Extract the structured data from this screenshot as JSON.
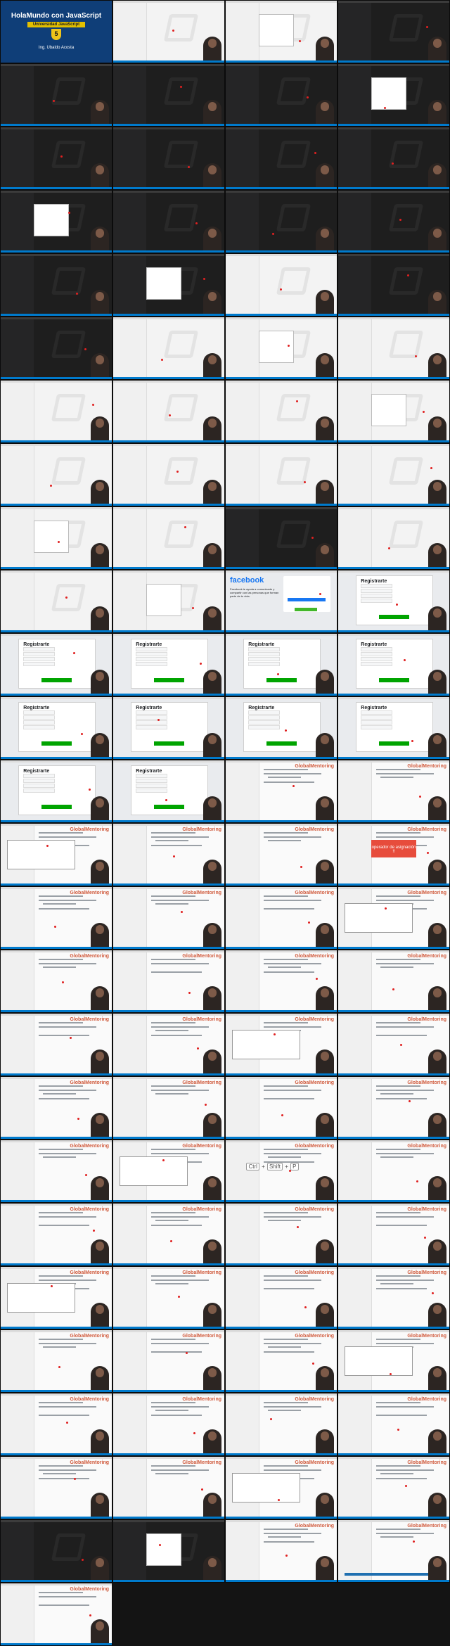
{
  "hero": {
    "title": "HolaMundo con JavaScript",
    "subtitle": "Universidad JavaScript",
    "author": "Ing. Ubaldo Acosta",
    "badge": "5"
  },
  "facebook": {
    "logo": "facebook",
    "tagline": "Facebook te ayuda a comunicarte y compartir con las personas que forman parte de tu vida."
  },
  "register": {
    "title": "Registrarte"
  },
  "callout": {
    "text": "operador de asignación !!"
  },
  "shortcut": {
    "keys": [
      "Ctrl",
      "Shift",
      "P"
    ]
  },
  "brand": {
    "logo_text": "GlobalMentoring"
  },
  "colors": {
    "vscode_blue": "#007acc",
    "facebook_blue": "#1877f2",
    "accent_red": "#e74c3c",
    "hero_bg": "#0f3e78"
  },
  "thumbnails": [
    "hero",
    "light",
    "light",
    "dark",
    "dark",
    "dark",
    "dark",
    "dark",
    "dark",
    "dark",
    "dark",
    "dark",
    "dark",
    "dark",
    "dark",
    "dark",
    "dark",
    "dark",
    "light",
    "dark",
    "dark",
    "light",
    "light",
    "light",
    "light",
    "light",
    "light",
    "light",
    "light",
    "light",
    "light",
    "light",
    "light",
    "light",
    "dark",
    "light",
    "light",
    "light",
    "fb",
    "register",
    "register",
    "register",
    "register",
    "register",
    "register",
    "register",
    "register",
    "register",
    "register",
    "register",
    "code",
    "code",
    "code",
    "code",
    "code",
    "callout",
    "code",
    "code",
    "code",
    "code",
    "code",
    "code",
    "code",
    "code",
    "code",
    "code",
    "code",
    "code",
    "code",
    "code",
    "code",
    "code",
    "code",
    "code",
    "keys",
    "code",
    "code",
    "code",
    "code",
    "code",
    "code",
    "code",
    "code",
    "code",
    "code",
    "code",
    "code",
    "code",
    "code",
    "code",
    "code",
    "code",
    "code",
    "code",
    "code",
    "code",
    "dark",
    "dark",
    "code",
    "subtitle",
    "code"
  ]
}
